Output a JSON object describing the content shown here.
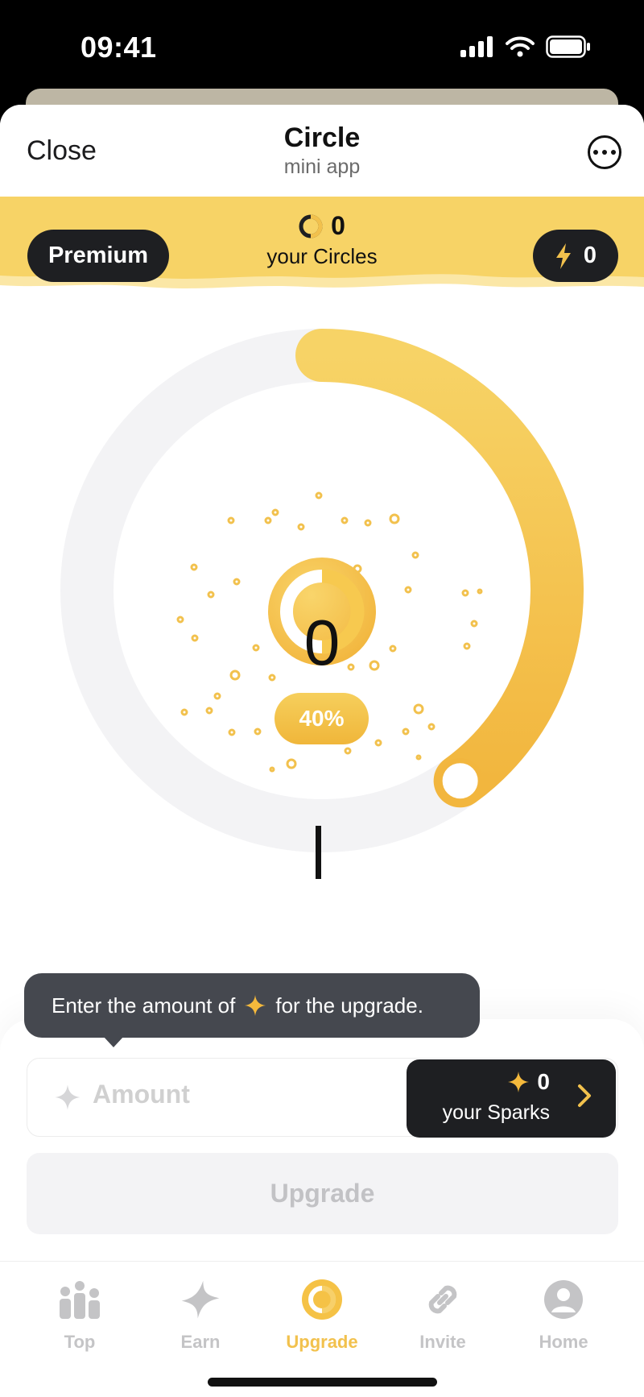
{
  "status_bar": {
    "time": "09:41"
  },
  "header": {
    "close_label": "Close",
    "title": "Circle",
    "subtitle": "mini app"
  },
  "banner": {
    "premium_label": "Premium",
    "circles_count": "0",
    "circles_label": "your Circles",
    "bolt_count": "0"
  },
  "meter": {
    "value": "0",
    "percent_label": "40%",
    "progress": 0.4
  },
  "tooltip": {
    "text_before": "Enter the amount of",
    "text_after": "for the upgrade."
  },
  "amount_input": {
    "placeholder": "Amount"
  },
  "sparks": {
    "count": "0",
    "label": "your Sparks"
  },
  "upgrade_button": {
    "label": "Upgrade"
  },
  "tabs": [
    {
      "label": "Top",
      "icon": "bars-people-icon",
      "active": false
    },
    {
      "label": "Earn",
      "icon": "sparkle-icon",
      "active": false
    },
    {
      "label": "Upgrade",
      "icon": "circle-coin-icon",
      "active": true
    },
    {
      "label": "Invite",
      "icon": "link-icon",
      "active": false
    },
    {
      "label": "Home",
      "icon": "person-icon",
      "active": false
    }
  ],
  "colors": {
    "accent": "#f2c14d",
    "dark": "#1e1f22",
    "banner": "#f7d366"
  }
}
